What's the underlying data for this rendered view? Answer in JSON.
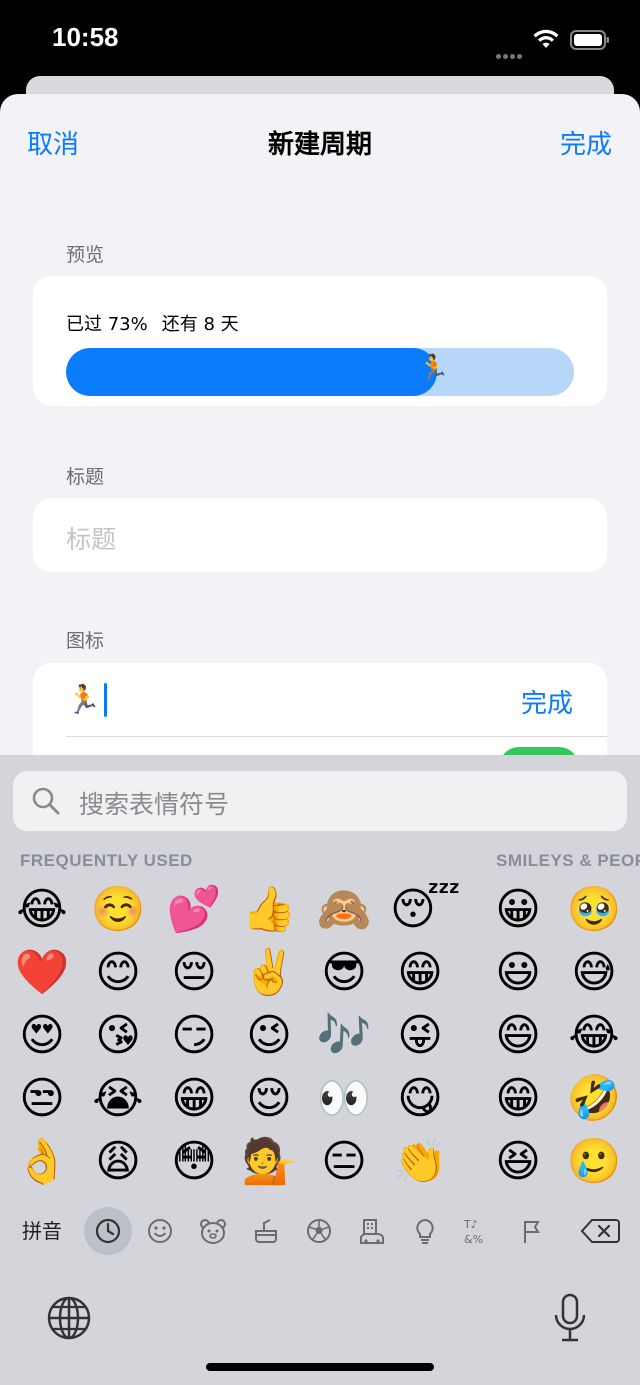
{
  "status": {
    "time": "10:58"
  },
  "nav": {
    "cancel": "取消",
    "title": "新建周期",
    "done": "完成"
  },
  "preview": {
    "label": "预览",
    "elapsed_text": "已过 73%",
    "remaining_text": "还有 8 天",
    "progress_fraction": 0.73,
    "runner_emoji": "🏃"
  },
  "title_field": {
    "label": "标题",
    "placeholder": "标题",
    "value": ""
  },
  "icon_field": {
    "label": "图标",
    "value": "🏃",
    "done": "完成",
    "toggle_on": true
  },
  "keyboard": {
    "search_placeholder": "搜索表情符号",
    "categories": [
      "FREQUENTLY USED",
      "SMILEYS & PEOPLE"
    ],
    "frequent": [
      [
        "😂",
        "☺️",
        "💕",
        "👍",
        "🙈",
        "😴"
      ],
      [
        "❤️",
        "😊",
        "😔",
        "✌️",
        "😎",
        "😁"
      ],
      [
        "😍",
        "😘",
        "😏",
        "😉",
        "🎶",
        "😜"
      ],
      [
        "😒",
        "😭",
        "😁",
        "😌",
        "👀",
        "😋"
      ],
      [
        "👌",
        "😩",
        "😳",
        "💁",
        "😑",
        "👏"
      ]
    ],
    "smileys": [
      [
        "😀",
        "🥹"
      ],
      [
        "😃",
        "😅"
      ],
      [
        "😄",
        "😂"
      ],
      [
        "😁",
        "🤣"
      ],
      [
        "😆",
        "🥲"
      ]
    ],
    "pinyin_label": "拼音",
    "tabs": [
      "clock-icon",
      "smiley-icon",
      "animal-icon",
      "food-icon",
      "ball-icon",
      "building-icon",
      "bulb-icon",
      "symbols-icon",
      "flag-icon",
      "delete-icon"
    ],
    "accent": "#0a7bfd"
  }
}
